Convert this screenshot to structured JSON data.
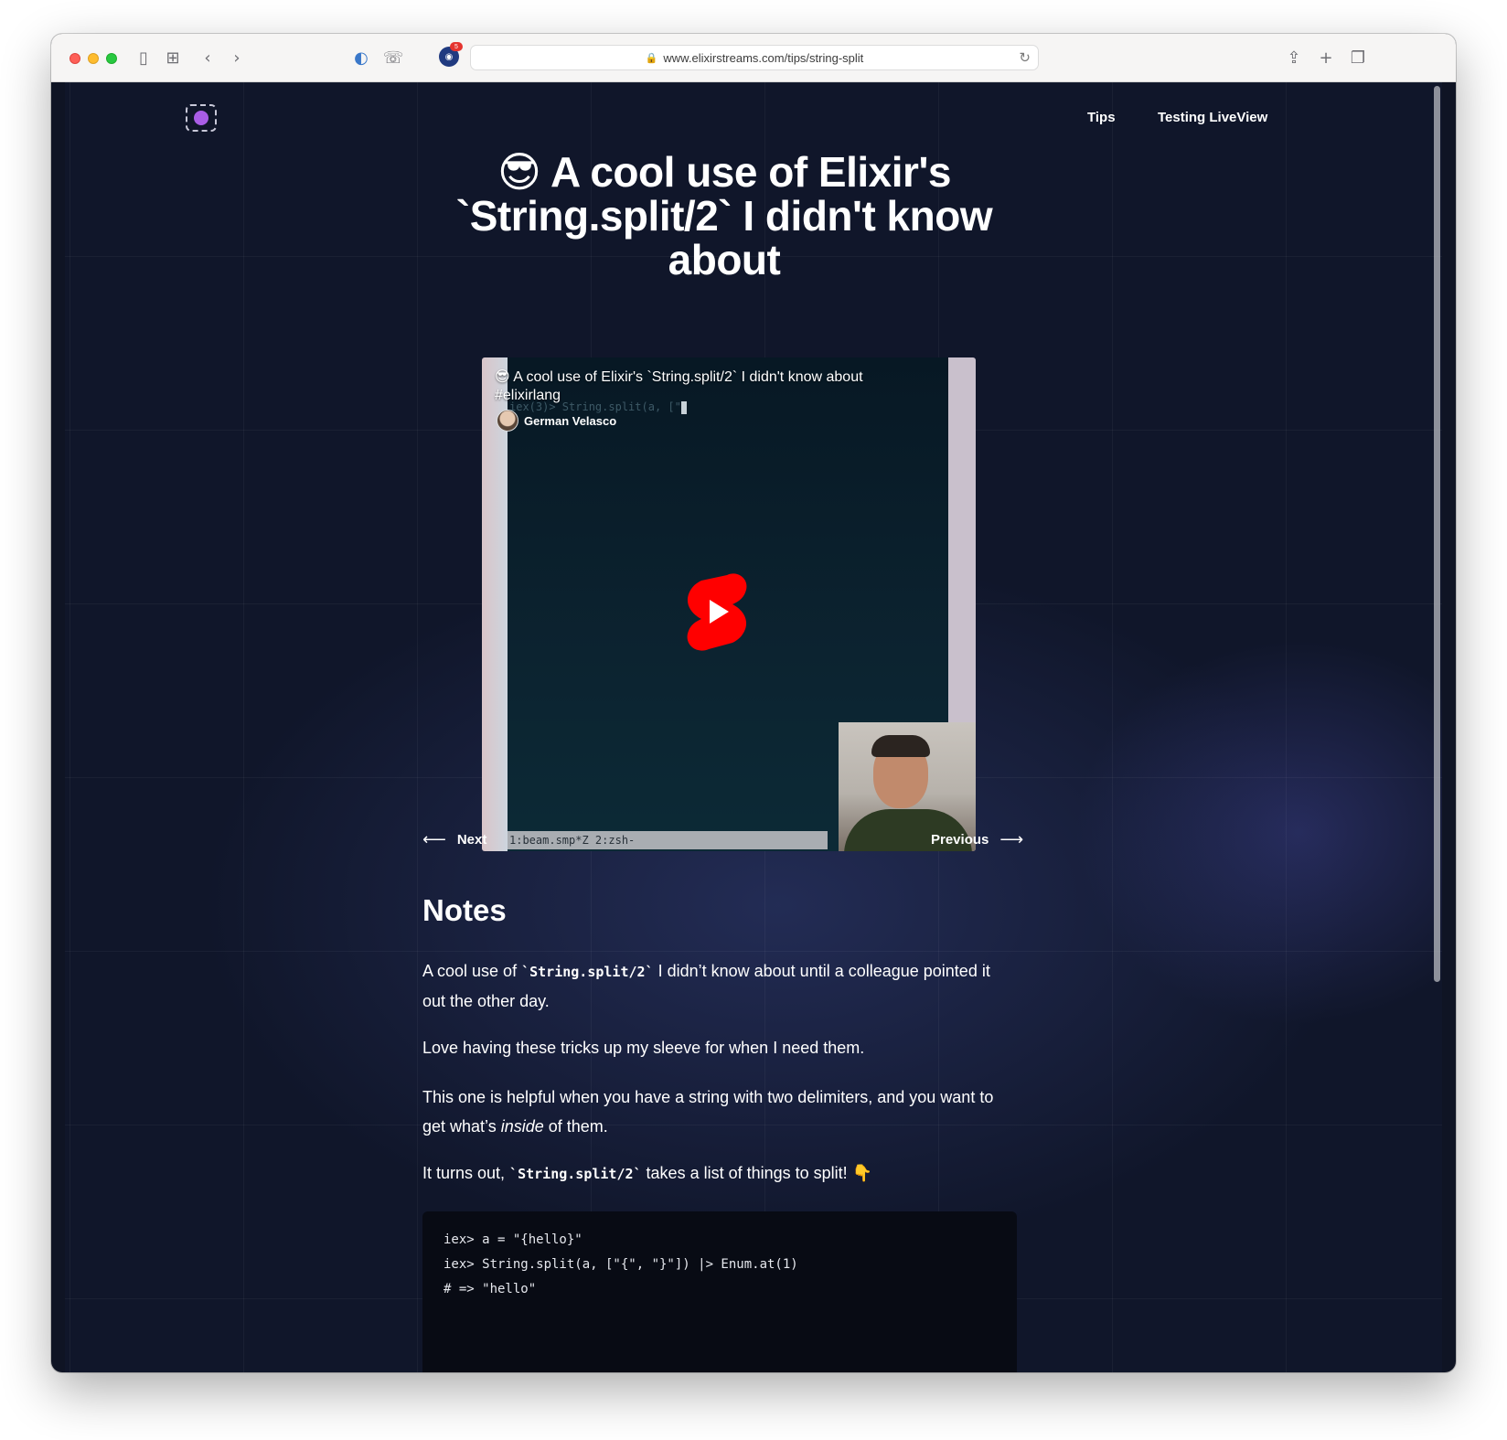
{
  "browser": {
    "url": "www.elixirstreams.com/tips/string-split",
    "extension_badge": "5"
  },
  "nav": {
    "tips": "Tips",
    "testing_liveview": "Testing LiveView"
  },
  "article": {
    "title": "😎 A cool use of Elixir's `String.split/2` I didn't know about"
  },
  "video": {
    "title": "😎 A cool use of Elixir's `String.split/2` I didn't know about #elixirlang",
    "channel": "German Velasco",
    "terminal_line": "iex(3)> String.split(a, [\"",
    "terminal_status": "1:beam.smp*Z 2:zsh-"
  },
  "pagination": {
    "next": "Next",
    "previous": "Previous"
  },
  "notes": {
    "heading": "Notes",
    "p1_before": "A cool use of ",
    "p1_code": "`String.split/2`",
    "p1_after": " I didn’t know about until a colleague pointed it out the other day.",
    "p2": "Love having these tricks up my sleeve for when I need them.",
    "p3_before": "This one is helpful when you have a string with two delimiters, and you want to get what’s ",
    "p3_em": "inside",
    "p3_after": " of them.",
    "p4_before": "It turns out, ",
    "p4_code": "`String.split/2`",
    "p4_after": " takes a list of things to split! 👇"
  },
  "code": {
    "lines": [
      "iex> a = \"{hello}\"",
      "iex> String.split(a, [\"{\", \"}\"]) |> Enum.at(1)",
      "# => \"hello\""
    ]
  },
  "colors": {
    "background": "#10162a",
    "play_button": "#ff0000",
    "code_background": "#080b14"
  }
}
